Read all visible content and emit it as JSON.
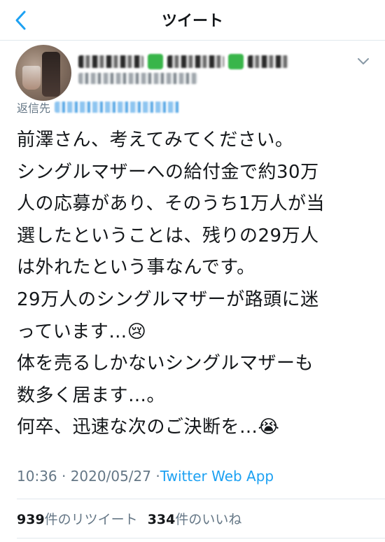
{
  "header": {
    "title": "ツイート",
    "back_icon": "chevron-left-icon",
    "accent_color": "#1da1f2"
  },
  "author": {
    "avatar": "avatar-photo",
    "name_redacted": true,
    "handle_redacted": true,
    "menu_icon": "chevron-down-icon"
  },
  "reply": {
    "label": "返信先"
  },
  "tweet": {
    "lines": [
      "前澤さん、考えてみてください。",
      "シングルマザーへの給付金で約30万",
      "人の応募があり、そのうち1万人が当",
      "選したということは、残りの29万人",
      "は外れたという事なんです。",
      "29万人のシングルマザーが路頭に迷",
      "っています…😢",
      "体を売るしかないシングルマザーも",
      "数多く居ます…。",
      "何卒、迅速な次のご決断を…😭"
    ]
  },
  "meta": {
    "time": "10:36 · 2020/05/27 · ",
    "app": "Twitter Web App"
  },
  "stats": {
    "retweets_count": "939",
    "retweets_label": "件のリツイート",
    "likes_count": "334",
    "likes_label": "件のいいね"
  }
}
